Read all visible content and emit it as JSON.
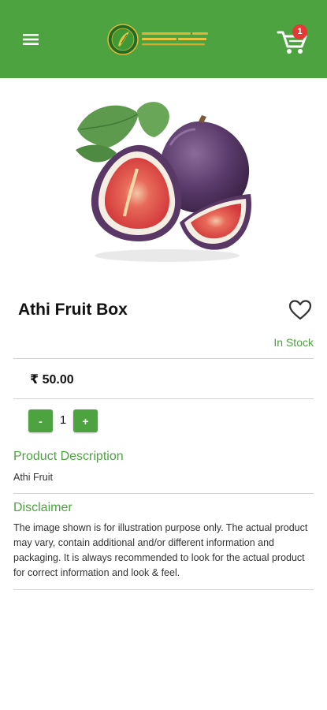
{
  "header": {
    "menu_icon": "hamburger-menu-icon",
    "cart_icon": "shopping-cart-icon",
    "cart_count": "1",
    "brand_color": "#4ca33f"
  },
  "product": {
    "image_description": "fig fruits",
    "name": "Athi Fruit Box",
    "wishlist_icon": "heart-outline-icon",
    "stock_status": "In Stock",
    "price": "₹ 50.00",
    "quantity": "1",
    "decrease_label": "-",
    "increase_label": "+"
  },
  "description": {
    "title": "Product Description",
    "text": "Athi Fruit"
  },
  "disclaimer": {
    "title": "Disclaimer",
    "text": "The image shown is for illustration purpose only. The actual product may vary, contain additional and/or different information and packaging. It is always recommended to look for the actual product for correct information and look & feel."
  }
}
